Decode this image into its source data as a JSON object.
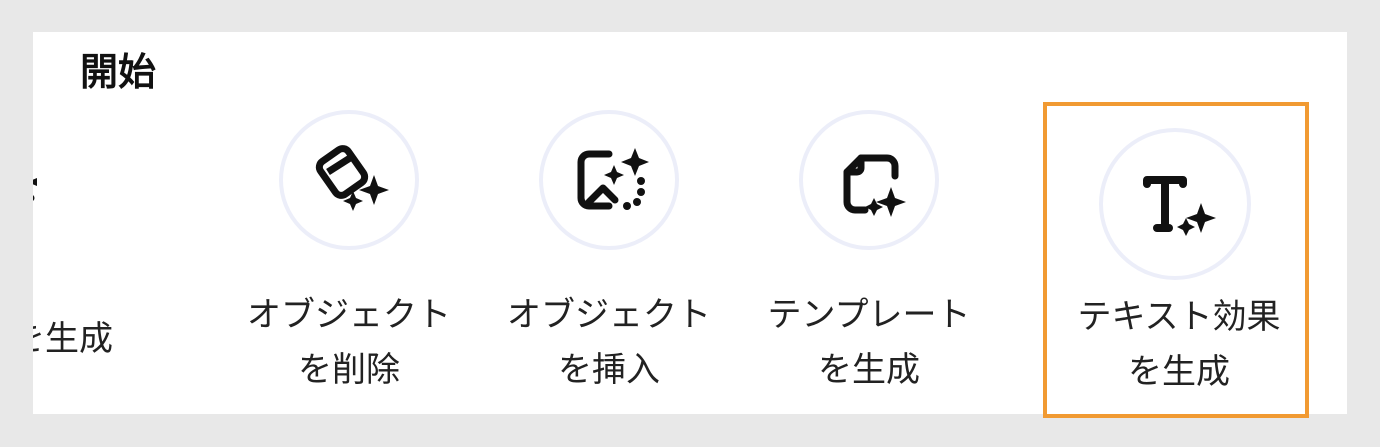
{
  "section": {
    "title": "開始"
  },
  "tiles": [
    {
      "line1": "像を生成",
      "line2": "",
      "icon": "image-sparkle-icon"
    },
    {
      "line1": "オブジェクト",
      "line2": "を削除",
      "icon": "eraser-sparkle-icon"
    },
    {
      "line1": "オブジェクト",
      "line2": "を挿入",
      "icon": "image-insert-sparkle-icon"
    },
    {
      "line1": "テンプレート",
      "line2": "を生成",
      "icon": "template-sparkle-icon"
    },
    {
      "line1": "テキスト効果",
      "line2": "を生成",
      "icon": "text-sparkle-icon"
    }
  ],
  "colors": {
    "selected_border": "#f19a32",
    "circle_border": "#eceef9"
  }
}
